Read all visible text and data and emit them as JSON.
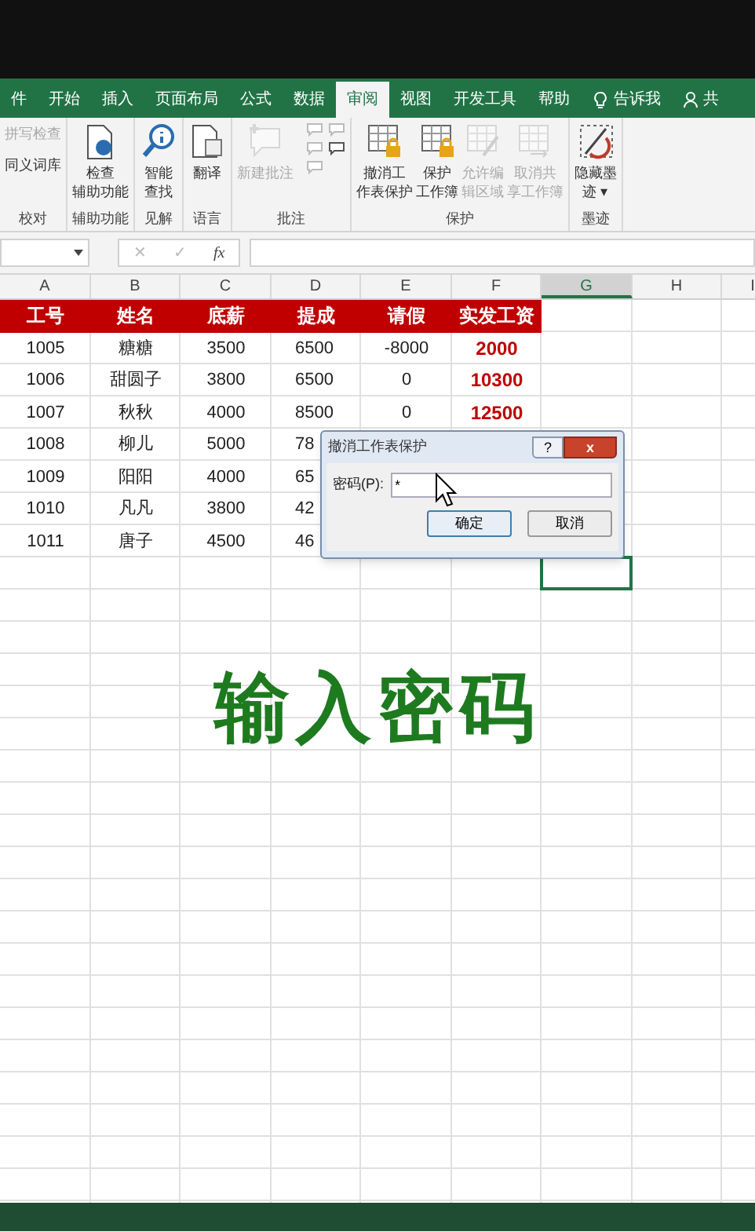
{
  "tabs": [
    {
      "label": "件",
      "selected": false
    },
    {
      "label": "开始",
      "selected": false
    },
    {
      "label": "插入",
      "selected": false
    },
    {
      "label": "页面布局",
      "selected": false
    },
    {
      "label": "公式",
      "selected": false
    },
    {
      "label": "数据",
      "selected": false
    },
    {
      "label": "审阅",
      "selected": true
    },
    {
      "label": "视图",
      "selected": false
    },
    {
      "label": "开发工具",
      "selected": false
    },
    {
      "label": "帮助",
      "selected": false
    }
  ],
  "tell_me": "告诉我",
  "share": "共",
  "ribbon_groups": [
    {
      "label": "校对",
      "buttons": [
        {
          "kind": "small",
          "lines": [
            "拼写检查"
          ],
          "disabled": true
        },
        {
          "kind": "small",
          "lines": [
            "同义词库"
          ],
          "disabled": false
        }
      ]
    },
    {
      "label": "辅助功能",
      "buttons": [
        {
          "kind": "doc",
          "lines": [
            "检查",
            "辅助功能"
          ],
          "disabled": false
        }
      ]
    },
    {
      "label": "见解",
      "buttons": [
        {
          "kind": "search",
          "lines": [
            "智能",
            "查找"
          ],
          "disabled": false
        }
      ]
    },
    {
      "label": "语言",
      "buttons": [
        {
          "kind": "translate",
          "lines": [
            "翻译"
          ],
          "disabled": false
        }
      ]
    },
    {
      "label": "批注",
      "buttons": [
        {
          "kind": "comment",
          "lines": [
            "新建批注"
          ],
          "disabled": true
        }
      ]
    },
    {
      "label": "保护",
      "buttons": [
        {
          "kind": "lock",
          "lines": [
            "撤消工",
            "作表保护"
          ],
          "disabled": false
        },
        {
          "kind": "lock",
          "lines": [
            "保护",
            "工作簿"
          ],
          "disabled": false
        },
        {
          "kind": "edit",
          "lines": [
            "允许编",
            "辑区域"
          ],
          "disabled": true
        },
        {
          "kind": "share",
          "lines": [
            "取消共",
            "享工作簿"
          ],
          "disabled": true
        }
      ]
    },
    {
      "label": "墨迹",
      "buttons": [
        {
          "kind": "ink",
          "lines": [
            "隐藏墨",
            "迹 ▾"
          ],
          "disabled": false
        }
      ]
    }
  ],
  "formula_bar": {
    "cancel": "✕",
    "enter": "✓",
    "fx": "fx"
  },
  "columns": [
    {
      "label": "A",
      "selected": false
    },
    {
      "label": "B",
      "selected": false
    },
    {
      "label": "C",
      "selected": false
    },
    {
      "label": "D",
      "selected": false
    },
    {
      "label": "E",
      "selected": false
    },
    {
      "label": "F",
      "selected": false
    },
    {
      "label": "G",
      "selected": true
    },
    {
      "label": "H",
      "selected": false
    },
    {
      "label": "I",
      "selected": false
    }
  ],
  "table": {
    "columns": [
      "工号",
      "姓名",
      "底薪",
      "提成",
      "请假",
      "实发工资"
    ],
    "rows": [
      [
        "1005",
        "糖糖",
        "3500",
        "6500",
        "-8000",
        "2000"
      ],
      [
        "1006",
        "甜圆子",
        "3800",
        "6500",
        "0",
        "10300"
      ],
      [
        "1007",
        "秋秋",
        "4000",
        "8500",
        "0",
        "12500"
      ],
      [
        "1008",
        "柳儿",
        "5000",
        "78",
        "",
        ""
      ],
      [
        "1009",
        "阳阳",
        "4000",
        "65",
        "",
        ""
      ],
      [
        "1010",
        "凡凡",
        "3800",
        "42",
        "",
        ""
      ],
      [
        "1011",
        "唐子",
        "4500",
        "46",
        "",
        ""
      ]
    ]
  },
  "dialog": {
    "title": "撤消工作表保护",
    "help": "?",
    "close": "x",
    "label": "密码(P):",
    "value": "*",
    "ok": "确定",
    "cancel": "取消"
  },
  "caption": "输入密码"
}
